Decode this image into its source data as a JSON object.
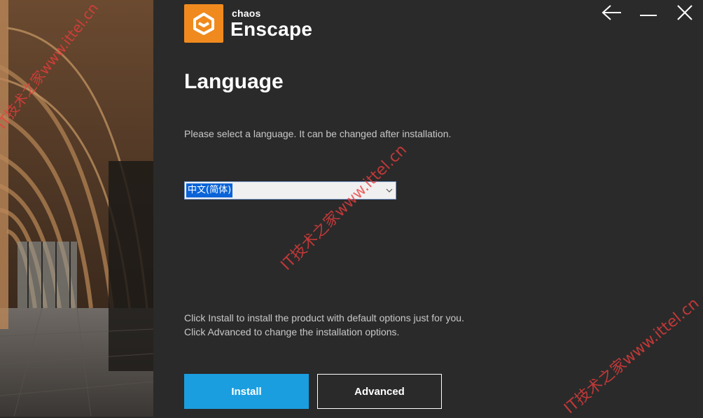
{
  "window_controls": {
    "back_icon": "arrow-left-icon",
    "minimize_icon": "minimize-icon",
    "close_icon": "close-icon"
  },
  "logo": {
    "brand": "chaos",
    "product": "Enscape",
    "mark_color": "#f08a1e"
  },
  "page": {
    "title": "Language",
    "subtitle": "Please select a language. It can be changed after installation."
  },
  "language_select": {
    "selected": "中文(简体)"
  },
  "info": {
    "line1": "Click Install to install the product with default options just for you.",
    "line2": "Click Advanced to change the installation options."
  },
  "buttons": {
    "install": "Install",
    "advanced": "Advanced"
  },
  "watermark": {
    "text": "IT技术之家www.ittel.cn"
  },
  "colors": {
    "background": "#2a2a2a",
    "accent": "#1a9ee0",
    "watermark": "#ec3c3c"
  }
}
